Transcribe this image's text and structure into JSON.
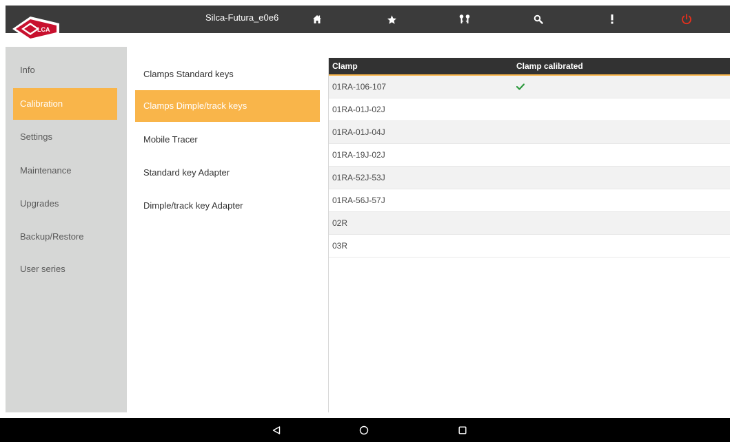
{
  "header": {
    "logo_text": "SILCA",
    "device_name": "Silca-Futura_e0e6",
    "icons": [
      "home-icon",
      "star-icon",
      "keys-icon",
      "search-icon",
      "more-icon",
      "power-icon"
    ],
    "accent_color": "#f9b54a",
    "power_color": "#e8301c"
  },
  "sidebar": {
    "items": [
      {
        "label": "Info",
        "active": false
      },
      {
        "label": "Calibration",
        "active": true
      },
      {
        "label": "Settings",
        "active": false
      },
      {
        "label": "Maintenance",
        "active": false
      },
      {
        "label": "Upgrades",
        "active": false
      },
      {
        "label": "Backup/Restore",
        "active": false
      },
      {
        "label": "User series",
        "active": false
      }
    ]
  },
  "submenu": {
    "items": [
      {
        "label": "Clamps Standard keys",
        "active": false
      },
      {
        "label": "Clamps Dimple/track keys",
        "active": true
      },
      {
        "label": "Mobile Tracer",
        "active": false
      },
      {
        "label": "Standard key Adapter",
        "active": false
      },
      {
        "label": "Dimple/track key Adapter",
        "active": false
      }
    ]
  },
  "table": {
    "columns": [
      "Clamp",
      "Clamp calibrated"
    ],
    "rows": [
      {
        "clamp": "01RA-106-107",
        "calibrated": true
      },
      {
        "clamp": "01RA-01J-02J",
        "calibrated": false
      },
      {
        "clamp": "01RA-01J-04J",
        "calibrated": false
      },
      {
        "clamp": "01RA-19J-02J",
        "calibrated": false
      },
      {
        "clamp": "01RA-52J-53J",
        "calibrated": false
      },
      {
        "clamp": "01RA-56J-57J",
        "calibrated": false
      },
      {
        "clamp": "02R",
        "calibrated": false
      },
      {
        "clamp": "03R",
        "calibrated": false
      }
    ],
    "check_color": "#2e9a3e"
  },
  "navbar": {
    "buttons": [
      "back-icon",
      "home-circle-icon",
      "recents-icon"
    ]
  }
}
